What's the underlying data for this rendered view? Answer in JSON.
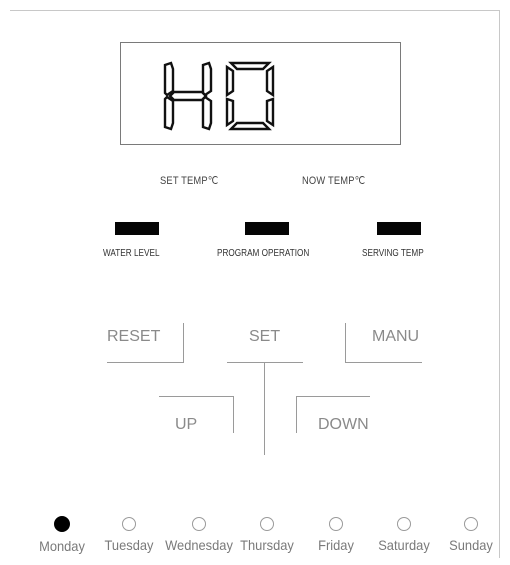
{
  "display": {
    "readout": "HO"
  },
  "temperature_labels": {
    "set_temp": "SET TEMP℃",
    "now_temp": "NOW TEMP℃"
  },
  "indicators": [
    {
      "label": "WATER LEVEL"
    },
    {
      "label": "PROGRAM OPERATION"
    },
    {
      "label": "SERVING TEMP"
    }
  ],
  "buttons": {
    "reset": "RESET",
    "set": "SET",
    "manu": "MANU",
    "up": "UP",
    "down": "DOWN"
  },
  "days": [
    {
      "label": "Monday",
      "selected": true
    },
    {
      "label": "Tuesday",
      "selected": false
    },
    {
      "label": "Wednesday",
      "selected": false
    },
    {
      "label": "Thursday",
      "selected": false
    },
    {
      "label": "Friday",
      "selected": false
    },
    {
      "label": "Saturday",
      "selected": false
    },
    {
      "label": "Sunday",
      "selected": false
    }
  ],
  "colors": {
    "indicator": "#050505",
    "button_text": "#8a8a8a",
    "selected_day": "#000000"
  }
}
